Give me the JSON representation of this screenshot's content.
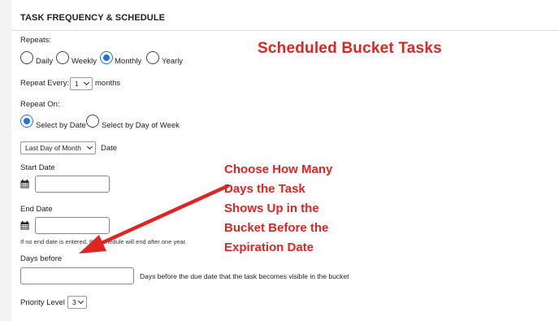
{
  "section": {
    "title": "TASK FREQUENCY & SCHEDULE"
  },
  "repeats": {
    "label": "Repeats:",
    "options": [
      {
        "label": "Daily",
        "checked": false
      },
      {
        "label": "Weekly",
        "checked": false
      },
      {
        "label": "Monthly",
        "checked": true
      },
      {
        "label": "Yearly",
        "checked": false
      }
    ]
  },
  "repeat_every": {
    "label": "Repeat Every:",
    "value": "1",
    "unit": "months"
  },
  "repeat_on": {
    "label": "Repeat On:",
    "options": [
      {
        "label": "Select by Date",
        "checked": true
      },
      {
        "label": "Select by Day of Week",
        "checked": false
      }
    ],
    "select_value": "Last Day of Month",
    "suffix": "Date"
  },
  "start_date": {
    "label": "Start Date",
    "value": "",
    "icon": "calendar-icon"
  },
  "end_date": {
    "label": "End Date",
    "value": "",
    "icon": "calendar-icon",
    "note": "If no end date is entered, the schedule will end after one year."
  },
  "days_before": {
    "label": "Days before",
    "value": "",
    "help": "Days before the due date that the task becomes visible in the bucket"
  },
  "priority": {
    "label": "Priority Level",
    "value": "3"
  },
  "annotations": {
    "title": "Scheduled Bucket Tasks",
    "callout_lines": [
      "Choose How Many",
      "Days the Task",
      "Shows Up in the",
      "Bucket Before the",
      "Expiration Date"
    ],
    "color": "#e02424"
  },
  "colors": {
    "accent": "#1a73e8",
    "annotation": "#e02424"
  }
}
